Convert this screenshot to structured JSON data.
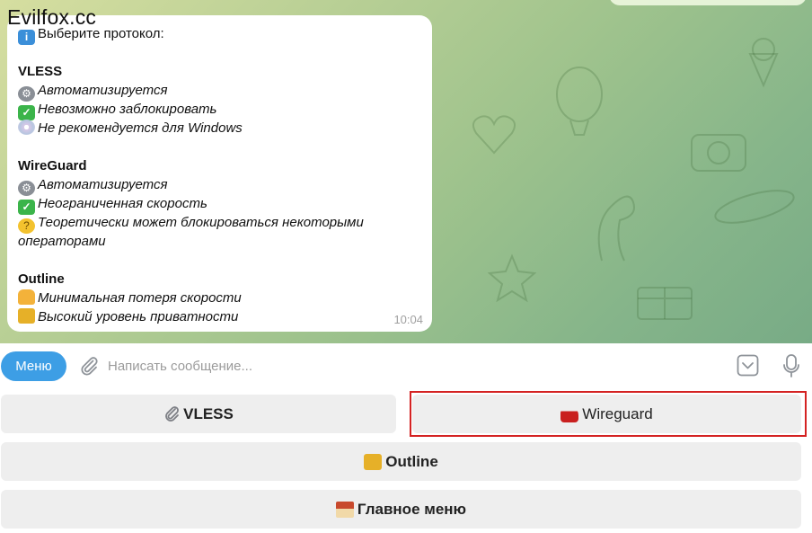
{
  "watermark": "Evilfox.cc",
  "message": {
    "header": "Выберите протокол:",
    "sections": [
      {
        "title": "VLESS",
        "items": [
          {
            "icon": "gear-icon",
            "text": "Автоматизируется"
          },
          {
            "icon": "check-icon",
            "text": "Невозможно заблокировать"
          },
          {
            "icon": "disc-icon",
            "text": "Не рекомендуется для Windows"
          }
        ]
      },
      {
        "title": "WireGuard",
        "items": [
          {
            "icon": "gear-icon",
            "text": "Автоматизируется"
          },
          {
            "icon": "check-icon",
            "text": "Неограниченная скорость"
          },
          {
            "icon": "thinking-face-icon",
            "text": "Теоретически может блокироваться некоторыми",
            "cont": "операторами"
          }
        ]
      },
      {
        "title": "Outline",
        "items": [
          {
            "icon": "person-laptop-icon",
            "text": "Минимальная потеря скорости"
          },
          {
            "icon": "lock-key-icon",
            "text": "Высокий уровень приватности"
          }
        ]
      }
    ],
    "time": "10:04"
  },
  "input_bar": {
    "menu_label": "Меню",
    "placeholder": "Написать сообщение..."
  },
  "keyboard": {
    "vless_label": "VLESS",
    "wireguard_label": "Wireguard",
    "outline_label": "Outline",
    "main_menu_label": "Главное меню"
  },
  "colors": {
    "accent": "#3d9ee5",
    "highlight": "#d42222",
    "button_bg": "#eeeeee"
  }
}
